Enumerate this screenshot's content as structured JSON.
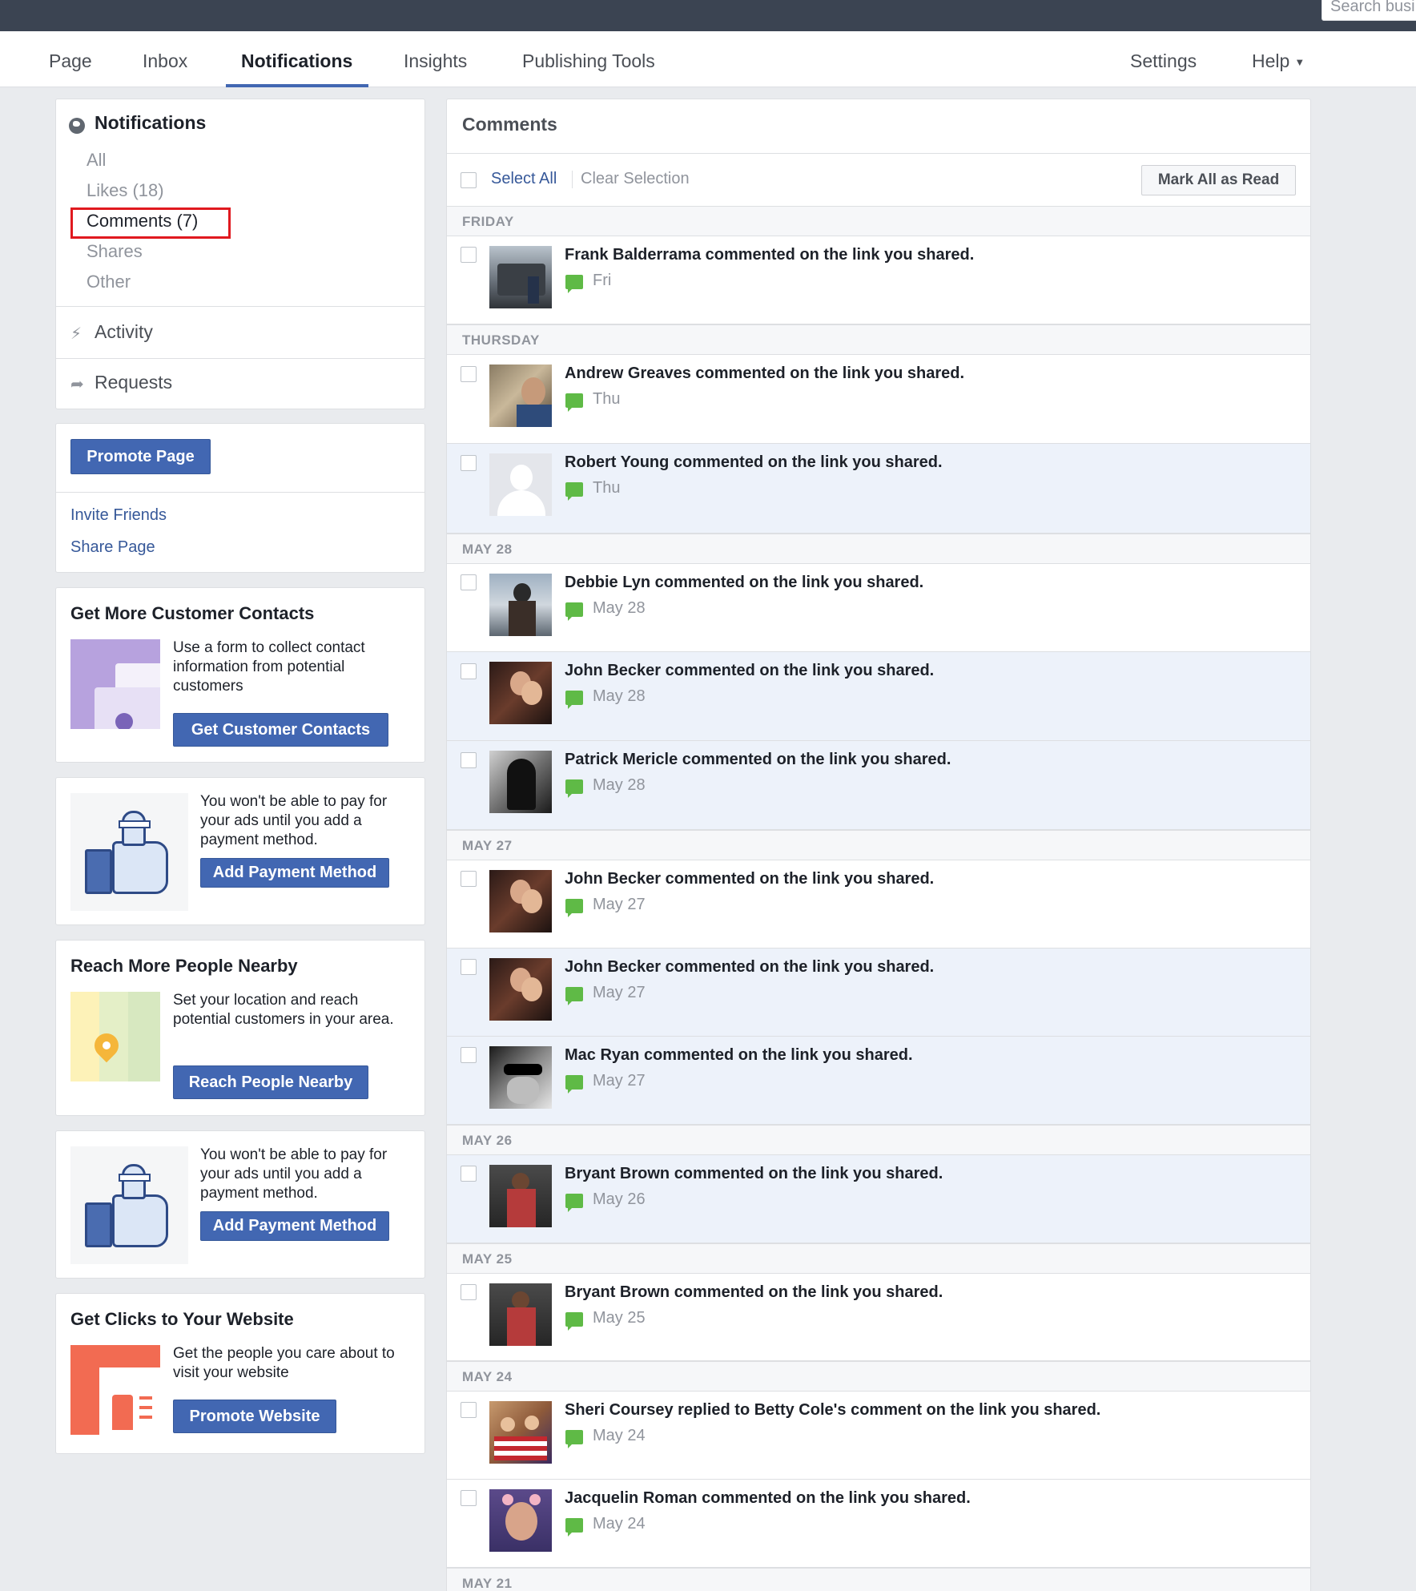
{
  "top_search": {
    "placeholder": "Search busi"
  },
  "tabs": [
    {
      "label": "Page"
    },
    {
      "label": "Inbox"
    },
    {
      "label": "Notifications"
    },
    {
      "label": "Insights"
    },
    {
      "label": "Publishing Tools"
    },
    {
      "label": "Settings"
    },
    {
      "label": "Help"
    }
  ],
  "sidebar": {
    "title": "Notifications",
    "filters": [
      "All",
      "Likes (18)",
      "Comments (7)",
      "Shares",
      "Other"
    ],
    "activity": "Activity",
    "requests": "Requests"
  },
  "promote": {
    "button": "Promote Page",
    "invite": "Invite Friends",
    "share": "Share Page"
  },
  "promos": [
    {
      "title": "Get More Customer Contacts",
      "text": "Use a form to collect contact information from potential customers",
      "button": "Get Customer Contacts"
    },
    {
      "title": "",
      "text": "You won't be able to pay for your ads until you add a payment method.",
      "button": "Add Payment Method"
    },
    {
      "title": "Reach More People Nearby",
      "text": "Set your location and reach potential customers in your area.",
      "button": "Reach People Nearby"
    },
    {
      "title": "",
      "text": "You won't be able to pay for your ads until you add a payment method.",
      "button": "Add Payment Method"
    },
    {
      "title": "Get Clicks to Your Website",
      "text": "Get the people you care about to visit your website",
      "button": "Promote Website"
    }
  ],
  "main": {
    "title": "Comments",
    "select_all": "Select All",
    "clear_selection": "Clear Selection",
    "mark_all_read": "Mark All as Read"
  },
  "groups": [
    {
      "day": "FRIDAY",
      "items": [
        {
          "name": "Frank Balderrama",
          "action": "commented on the link you shared.",
          "time": "Fri"
        }
      ]
    },
    {
      "day": "THURSDAY",
      "items": [
        {
          "name": "Andrew Greaves",
          "action": "commented on the link you shared.",
          "time": "Thu"
        },
        {
          "name": "Robert Young",
          "action": "commented on the link you shared.",
          "time": "Thu"
        }
      ]
    },
    {
      "day": "MAY 28",
      "items": [
        {
          "name": "Debbie Lyn",
          "action": "commented on the link you shared.",
          "time": "May 28"
        },
        {
          "name": "John Becker",
          "action": "commented on the link you shared.",
          "time": "May 28"
        },
        {
          "name": "Patrick Mericle",
          "action": "commented on the link you shared.",
          "time": "May 28"
        }
      ]
    },
    {
      "day": "MAY 27",
      "items": [
        {
          "name": "John Becker",
          "action": "commented on the link you shared.",
          "time": "May 27"
        },
        {
          "name": "John Becker",
          "action": "commented on the link you shared.",
          "time": "May 27"
        },
        {
          "name": "Mac Ryan",
          "action": "commented on the link you shared.",
          "time": "May 27"
        }
      ]
    },
    {
      "day": "MAY 26",
      "items": [
        {
          "name": "Bryant Brown",
          "action": "commented on the link you shared.",
          "time": "May 26"
        }
      ]
    },
    {
      "day": "MAY 25",
      "items": [
        {
          "name": "Bryant Brown",
          "action": "commented on the link you shared.",
          "time": "May 25"
        }
      ]
    },
    {
      "day": "MAY 24",
      "items": [
        {
          "name": "Sheri Coursey",
          "action": "replied to Betty Cole's comment on the link you shared.",
          "time": "May 24"
        },
        {
          "name": "Jacquelin Roman",
          "action": "commented on the link you shared.",
          "time": "May 24"
        }
      ]
    },
    {
      "day": "MAY 21",
      "items": []
    }
  ],
  "colors": {
    "accent": "#4267b2",
    "topbar": "#3b4452",
    "unread_bg": "#edf2fa",
    "comment_icon": "#5fba46",
    "highlight": "#e0191f"
  }
}
